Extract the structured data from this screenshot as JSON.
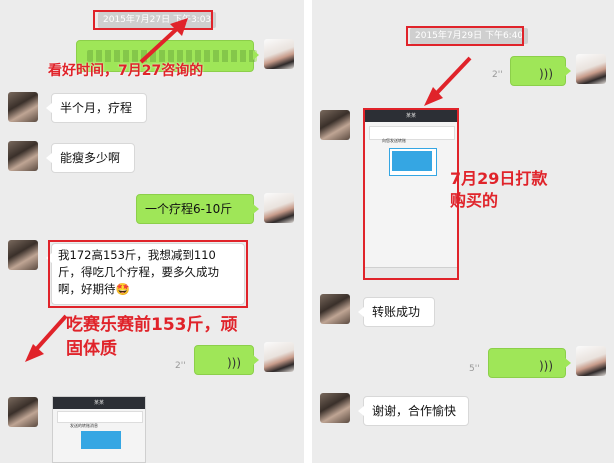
{
  "left_panel": {
    "timestamp": "2015年7月27日 下午3:03",
    "annotation_top": "看好时间，7月27咨询的",
    "messages": [
      {
        "side": "in",
        "text": "半个月，疗程"
      },
      {
        "side": "in",
        "text": "能瘦多少啊"
      },
      {
        "side": "out",
        "text": "一个疗程6-10斤"
      },
      {
        "side": "in",
        "text": "我172高153斤，我想减到110斤，得吃几个疗程，要多久成功啊，好期待🤩"
      },
      {
        "side": "out",
        "type": "voice",
        "duration": "2''"
      }
    ],
    "annotation_bottom": "吃赛乐赛前153斤，顽固体质",
    "phone_mock": {
      "title": "某某",
      "line": "发送的转账消息"
    }
  },
  "right_panel": {
    "timestamp": "2015年7月29日 下午6:40",
    "voice_top_duration": "2''",
    "annotation": "7月29日打款购买的",
    "phone_mock": {
      "title": "某某",
      "line": "向您发送转账"
    },
    "messages": [
      {
        "side": "in",
        "text": "转账成功"
      },
      {
        "side": "out",
        "type": "voice",
        "duration": "5''"
      },
      {
        "side": "in",
        "text": "谢谢，合作愉快"
      }
    ]
  },
  "colors": {
    "annotation_red": "#e0232a",
    "bubble_green": "#9fe658",
    "chat_bg": "#ececec",
    "phone_blue": "#35a6e3"
  }
}
